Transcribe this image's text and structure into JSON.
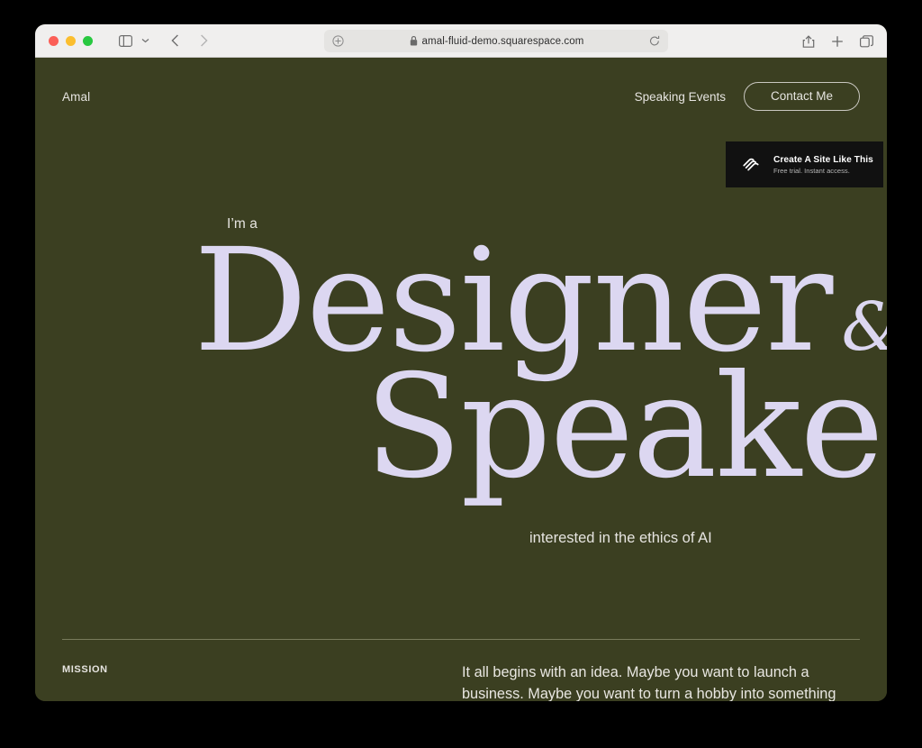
{
  "browser": {
    "url": "amal-fluid-demo.squarespace.com",
    "icons": {
      "sidebar": "sidebar-icon",
      "sidebar_chevron": "chevron-down-icon",
      "back": "chevron-left-icon",
      "forward": "chevron-right-icon",
      "reader": "reader-mode-icon",
      "lock": "lock-icon",
      "reload": "reload-icon",
      "share": "share-icon",
      "new_tab": "plus-icon",
      "tab_overview": "tab-overview-icon"
    },
    "traffic_lights": [
      {
        "name": "close",
        "color": "#fb5f57"
      },
      {
        "name": "minimize",
        "color": "#fbbe2e"
      },
      {
        "name": "maximize",
        "color": "#28c840"
      }
    ]
  },
  "site": {
    "logo": "Amal",
    "nav": {
      "link": "Speaking Events",
      "cta": "Contact Me"
    },
    "hero": {
      "eyebrow": "I’m a",
      "word_1": "Designer",
      "ampersand": "&",
      "word_2": "Speaker",
      "subtitle": "interested in the ethics of AI"
    },
    "mission": {
      "label": "MISSION",
      "text": "It all begins with an idea. Maybe you want to launch a business. Maybe you want to turn a hobby into something more. Don’t worry about it, be professional. Sound like you. There are many"
    },
    "colors": {
      "background": "#3B3F21",
      "headline": "#DCD7F1",
      "body_text": "#E6E4E0",
      "divider": "#8E9070"
    }
  },
  "promo": {
    "title": "Create A Site Like This",
    "subtitle": "Free trial. Instant access.",
    "icon": "squarespace-logo-icon",
    "background": "#111111"
  }
}
